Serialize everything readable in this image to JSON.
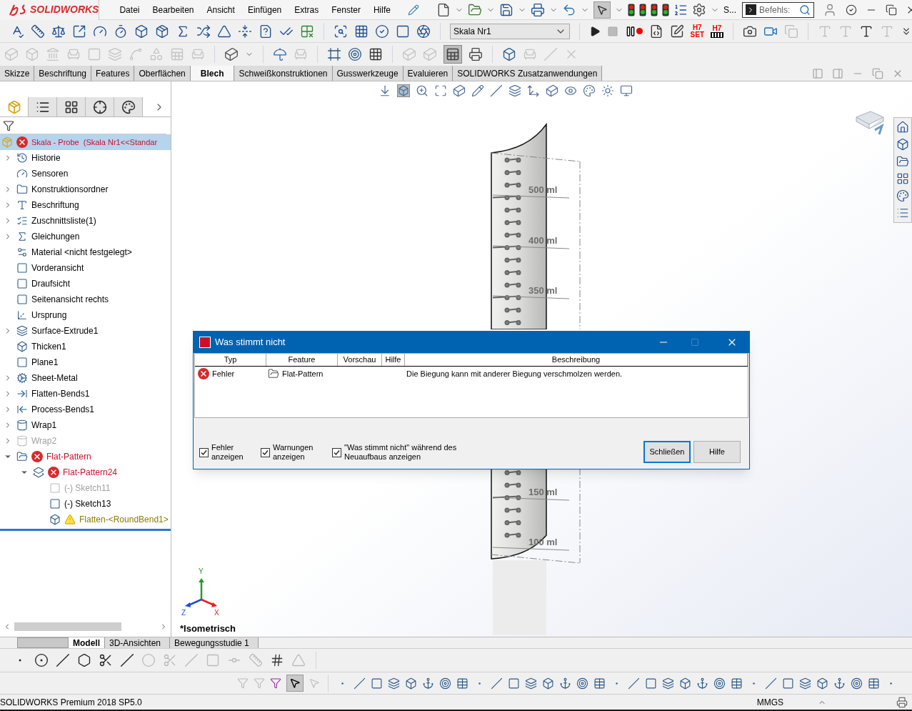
{
  "logo": {
    "text": "SOLIDWORKS"
  },
  "menu": [
    "Datei",
    "Bearbeiten",
    "Ansicht",
    "Einfügen",
    "Extras",
    "Fenster",
    "Hilfe"
  ],
  "top_bar": {
    "truncated_label": "S...",
    "command_search": {
      "placeholder": "Befehls:"
    }
  },
  "configuration": {
    "value": "Skala Nr1"
  },
  "tolerance_buttons": [
    {
      "top": "H7",
      "bottom": "SET"
    },
    {
      "top": "H7"
    }
  ],
  "command_tabs": [
    {
      "label": "Skizze",
      "selected": false
    },
    {
      "label": "Beschriftung",
      "selected": false
    },
    {
      "label": "Features",
      "selected": false
    },
    {
      "label": "Oberflächen",
      "selected": false
    },
    {
      "label": "Blech",
      "selected": true
    },
    {
      "label": "Schweißkonstruktionen",
      "selected": false
    },
    {
      "label": "Gusswerkzeuge",
      "selected": false
    },
    {
      "label": "Evaluieren",
      "selected": false
    },
    {
      "label": "SOLIDWORKS Zusatzanwendungen",
      "selected": false
    }
  ],
  "panel_tabs": [
    {
      "selected": true
    },
    {
      "selected": false
    },
    {
      "selected": false
    },
    {
      "selected": false
    },
    {
      "selected": false
    }
  ],
  "tree": {
    "root": {
      "label": "Skala - Probe  (Skala Nr1<<Standar",
      "selected": true,
      "error": true
    },
    "items": [
      {
        "label": "Historie",
        "expanded": false
      },
      {
        "label": "Sensoren"
      },
      {
        "label": "Konstruktionsordner",
        "expanded": false
      },
      {
        "label": "Beschriftung",
        "expanded": false
      },
      {
        "label": "Zuschnittsliste(1)",
        "expanded": false
      },
      {
        "label": "Gleichungen",
        "expanded": false
      },
      {
        "label": "Material <nicht festgelegt>"
      },
      {
        "label": "Vorderansicht"
      },
      {
        "label": "Draufsicht"
      },
      {
        "label": "Seitenansicht rechts"
      },
      {
        "label": "Ursprung"
      },
      {
        "label": "Surface-Extrude1",
        "expanded": false
      },
      {
        "label": "Thicken1"
      },
      {
        "label": "Plane1"
      },
      {
        "label": "Sheet-Metal",
        "expanded": false
      },
      {
        "label": "Flatten-Bends1",
        "expanded": false
      },
      {
        "label": "Process-Bends1",
        "expanded": false
      },
      {
        "label": "Wrap1",
        "expanded": false
      },
      {
        "label": "Wrap2",
        "expanded": false,
        "disabled": true
      },
      {
        "label": "Flat-Pattern",
        "expanded": true,
        "error": true,
        "children": [
          {
            "label": "Flat-Pattern24",
            "expanded": true,
            "error": true,
            "children": [
              {
                "label": "(-) Sketch11",
                "disabled": true
              },
              {
                "label": "(-) Sketch13"
              },
              {
                "label": "Flatten-<RoundBend1>",
                "warning": true
              }
            ]
          }
        ]
      }
    ]
  },
  "viewport": {
    "view_name": "*Isometrisch",
    "scale_labels": [
      "500 ml",
      "400 ml",
      "350 ml",
      "150 ml",
      "100 ml"
    ],
    "triad_axes": [
      "Y",
      "Z",
      "X"
    ]
  },
  "bottom_tabs": [
    {
      "label": "Modell",
      "selected": true
    },
    {
      "label": "3D-Ansichten",
      "selected": false
    },
    {
      "label": "Bewegungsstudie 1",
      "selected": false
    }
  ],
  "dialog": {
    "title": "Was stimmt nicht",
    "columns": [
      "Typ",
      "Feature",
      "Vorschau",
      "Hilfe",
      "Beschreibung"
    ],
    "rows": [
      {
        "type": "Fehler",
        "feature": "Flat-Pattern",
        "description": "Die Biegung kann mit anderer Biegung verschmolzen werden."
      }
    ],
    "options": [
      {
        "label": "Fehler anzeigen",
        "checked": true
      },
      {
        "label": "Warnungen anzeigen",
        "checked": true
      },
      {
        "label": "\"Was stimmt nicht\" während des Neuaufbaus anzeigen",
        "checked": true
      }
    ],
    "buttons": [
      {
        "label": "Schließen",
        "focused": true
      },
      {
        "label": "Hilfe",
        "focused": false
      }
    ]
  },
  "status_bar": {
    "product": "SOLIDWORKS Premium 2018 SP5.0",
    "units": "MMGS"
  }
}
